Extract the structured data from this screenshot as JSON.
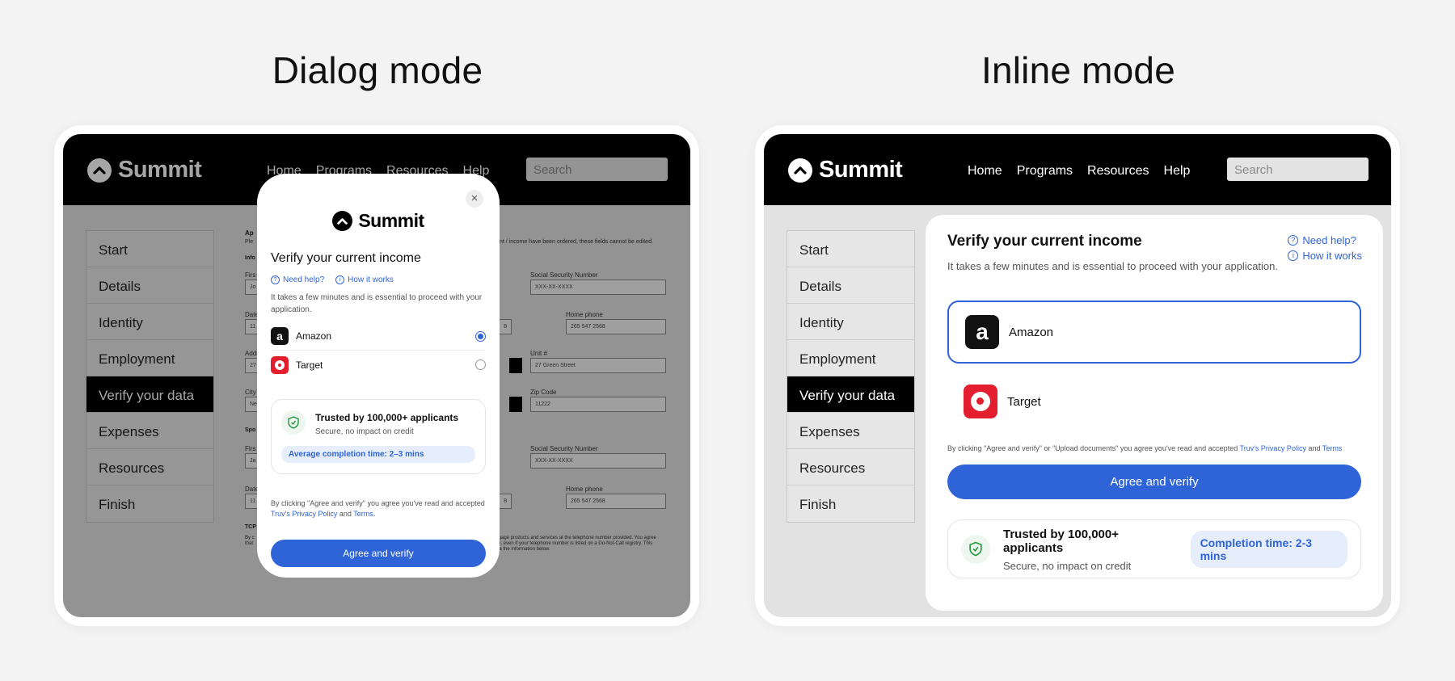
{
  "headings": {
    "dialog": "Dialog mode",
    "inline": "Inline mode"
  },
  "app": {
    "brand": "Summit",
    "nav": [
      "Home",
      "Programs",
      "Resources",
      "Help"
    ],
    "search_placeholder": "Search",
    "sidebar": [
      "Start",
      "Details",
      "Identity",
      "Employment",
      "Verify your data",
      "Expenses",
      "Resources",
      "Finish"
    ],
    "active_step": "Verify your data"
  },
  "form_bg": {
    "title": "Ap",
    "notice": "Ple",
    "notice_tail": "nt / income have been ordered, these fields cannot be edited.",
    "sections": [
      "Info",
      "Spo",
      "TCP"
    ],
    "labels": [
      "Firs",
      "Social Security Number",
      "Date",
      "Home phone",
      "Addr",
      "Unit #",
      "City",
      "Zip Code",
      "Firs",
      "Social Security Number",
      "Date",
      "Home phone"
    ],
    "values": [
      "Jo",
      "XXX-XX-XXXX",
      "11",
      "8",
      "265 547 2568",
      "27",
      "27 Green Street",
      "Ne",
      "11222",
      "Ja",
      "XXX-XX-XXXX",
      "11",
      "8",
      "265 547 2568"
    ],
    "tcp_text": [
      "By c",
      "that",
      "rtgage products and services at the telephone number provided. You agree",
      "ce, even if your telephone number is listed on a Do-Not-Call registry. This",
      "via the information below."
    ]
  },
  "dialog": {
    "close": "×",
    "title": "Verify your current income",
    "need_help": "Need help?",
    "how_it_works": "How it works",
    "subtitle": "It takes a few minutes and is essential to proceed with your application.",
    "providers": [
      {
        "name": "Amazon",
        "selected": true
      },
      {
        "name": "Target",
        "selected": false
      }
    ],
    "trust_title": "Trusted by 100,000+ applicants",
    "trust_sub": "Secure, no impact on credit",
    "badge": "Average completion time: 2–3 mins",
    "consent_pre": "By clicking \"Agree and verify\" you agree you've read and accepted ",
    "privacy": "Truv's Privacy Policy",
    "and": " and ",
    "terms": "Terms",
    "period": ".",
    "button": "Agree and verify"
  },
  "inline": {
    "title": "Verify your current income",
    "subtitle": "It takes a few minutes and is essential to proceed with your application.",
    "need_help": "Need help?",
    "how_it_works": "How it works",
    "providers": [
      {
        "name": "Amazon",
        "selected": true
      },
      {
        "name": "Target",
        "selected": false
      }
    ],
    "consent_pre": "By clicking \"Agree and verify\" or \"Upload documents\" you agree you've read and accepted ",
    "privacy": "Truv's Privacy Policy",
    "and": " and ",
    "terms": "Terms",
    "button": "Agree and verify",
    "trust_title": "Trusted by 100,000+ applicants",
    "trust_sub": "Secure, no impact on credit",
    "badge": "Completion time: 2-3 mins"
  },
  "icons": {
    "amazon": "a",
    "shield_color": "#2e9b47",
    "accent": "#2f64d8",
    "target_color": "#e21e2f"
  }
}
